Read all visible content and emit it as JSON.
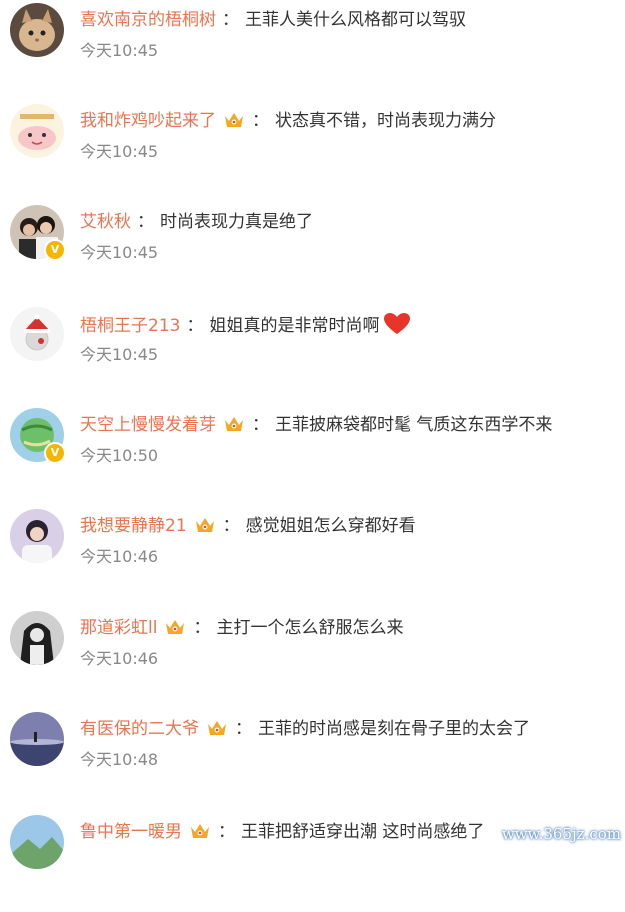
{
  "comments": [
    {
      "username": "喜欢南京的梧桐树",
      "crown": false,
      "verified": false,
      "text": "王菲人美什么风格都可以驾驭",
      "heart": false,
      "time": "今天10:45",
      "avatar": "cat-avatar"
    },
    {
      "username": "我和炸鸡吵起来了",
      "crown": true,
      "verified": false,
      "text": "状态真不错，时尚表现力满分",
      "heart": false,
      "time": "今天10:45",
      "avatar": "cartoon-avatar"
    },
    {
      "username": "艾秋秋",
      "crown": false,
      "verified": true,
      "text": "时尚表现力真是绝了",
      "heart": false,
      "time": "今天10:45",
      "avatar": "couple-photo-avatar"
    },
    {
      "username": "梧桐王子213",
      "crown": false,
      "verified": false,
      "text": "姐姐真的是非常时尚啊",
      "heart": true,
      "time": "今天10:45",
      "avatar": "santa-ornament-avatar"
    },
    {
      "username": "天空上慢慢发着芽",
      "crown": true,
      "verified": true,
      "text": "王菲披麻袋都时髦 气质这东西学不来",
      "heart": false,
      "time": "今天10:50",
      "avatar": "globe-avatar"
    },
    {
      "username": "我想要静静21",
      "crown": true,
      "verified": false,
      "text": "感觉姐姐怎么穿都好看",
      "heart": false,
      "time": "今天10:46",
      "avatar": "girl-photo-avatar"
    },
    {
      "username": "那道彩虹ll",
      "crown": true,
      "verified": false,
      "text": "主打一个怎么舒服怎么来",
      "heart": false,
      "time": "今天10:46",
      "avatar": "woman-bw-avatar"
    },
    {
      "username": "有医保的二大爷",
      "crown": true,
      "verified": false,
      "text": "王菲的时尚感是刻在骨子里的太会了",
      "heart": false,
      "time": "今天10:48",
      "avatar": "lake-avatar"
    },
    {
      "username": "鲁中第一暖男",
      "crown": true,
      "verified": false,
      "text": "王菲把舒适穿出潮 这时尚感绝了",
      "heart": false,
      "time": "",
      "avatar": "landscape-avatar"
    }
  ],
  "separator": "：",
  "verified_mark": "V",
  "watermark": "www.365jz.com",
  "colors": {
    "username": "#eb7350",
    "text": "#333333",
    "time": "#888888",
    "crown": "#f5a623",
    "verified": "#f6b500",
    "heart": "#e8352b"
  }
}
